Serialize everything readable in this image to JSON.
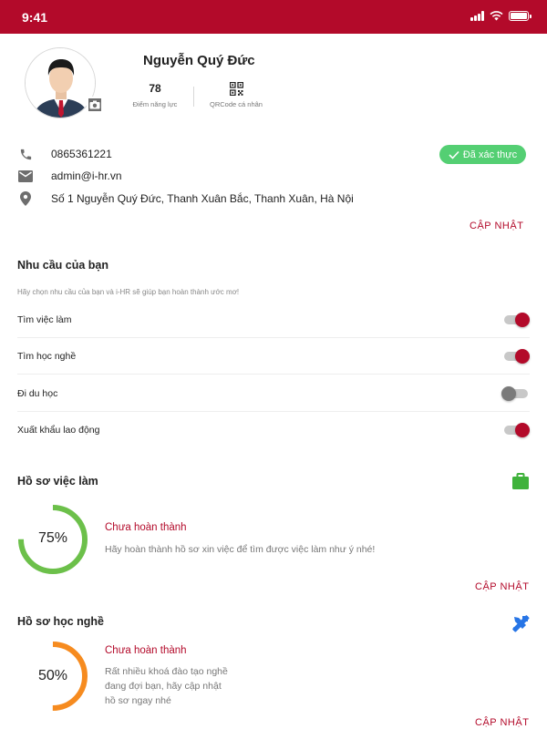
{
  "status_bar": {
    "time": "9:41"
  },
  "profile": {
    "name": "Nguyễn Quý Đức",
    "points_value": "78",
    "points_label": "Điểm năng lực",
    "qr_label": "QRCode cá nhân"
  },
  "contact": {
    "phone": "0865361221",
    "email": "admin@i-hr.vn",
    "address": "Số 1 Nguyễn Quý Đức, Thanh Xuân Bắc, Thanh Xuân, Hà Nội",
    "verified_label": "Đã xác thực",
    "update_label": "CẬP NHẬT"
  },
  "needs": {
    "title": "Nhu cầu của bạn",
    "hint": "Hãy chọn nhu cầu của bạn và i-HR sẽ giúp bạn hoàn thành ước mơ!",
    "items": [
      {
        "label": "Tìm việc làm",
        "enabled": true
      },
      {
        "label": "Tìm học nghề",
        "enabled": true
      },
      {
        "label": "Đi du học",
        "enabled": false
      },
      {
        "label": "Xuất khẩu lao động",
        "enabled": true
      }
    ]
  },
  "job_profile": {
    "title": "Hồ sơ việc làm",
    "progress": 75,
    "progress_label": "75%",
    "status": "Chưa hoàn thành",
    "description": "Hãy hoàn thành hồ sơ xin việc để tìm được việc làm như ý nhé!",
    "update_label": "CẬP NHẬT",
    "color": "#6cc04a",
    "icon": "briefcase-icon"
  },
  "vocational_profile": {
    "title": "Hồ sơ học nghề",
    "progress": 50,
    "progress_label": "50%",
    "status": "Chưa hoàn thành",
    "description_lines": [
      "Rất nhiều khoá đào tạo nghề",
      "đang đợi bạn, hãy cập nhật",
      "hồ sơ ngay nhé"
    ],
    "update_label": "CẬP NHẬT",
    "color": "#f68b1f",
    "icon": "pencil-ruler-icon"
  },
  "colors": {
    "brand": "#b30a2a",
    "verified": "#54cf73"
  }
}
